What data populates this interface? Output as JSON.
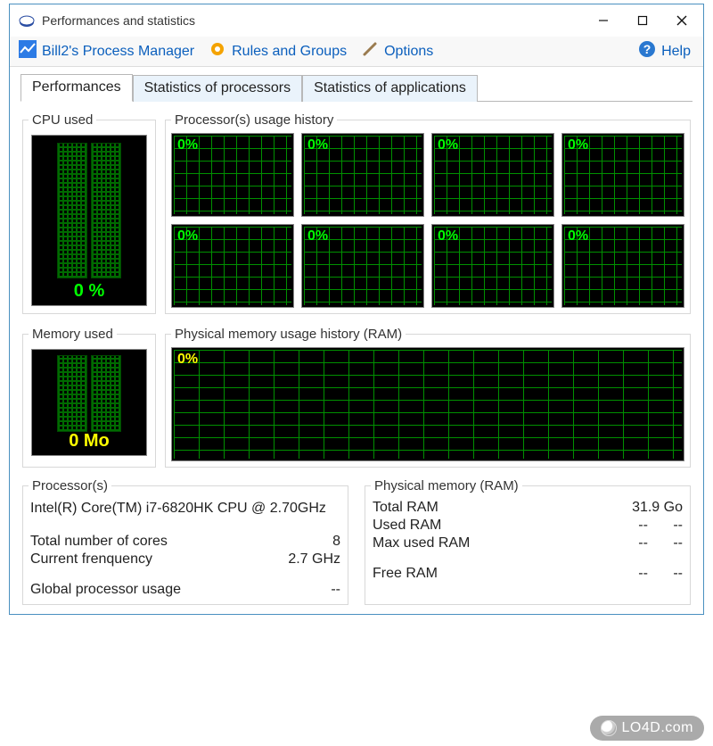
{
  "window": {
    "title": "Performances and statistics"
  },
  "toolbar": {
    "process_manager": "Bill2's Process Manager",
    "rules_groups": "Rules and Groups",
    "options": "Options",
    "help": "Help"
  },
  "tabs": [
    {
      "label": "Performances"
    },
    {
      "label": "Statistics of processors"
    },
    {
      "label": "Statistics of applications"
    }
  ],
  "groups": {
    "cpu_used": "CPU used",
    "proc_history": "Processor(s) usage history",
    "mem_used": "Memory used",
    "mem_history": "Physical memory usage history (RAM)",
    "processors": "Processor(s)",
    "physical_memory": "Physical memory (RAM)"
  },
  "cpu": {
    "big_value": "0 %",
    "cores": [
      "0%",
      "0%",
      "0%",
      "0%",
      "0%",
      "0%",
      "0%",
      "0%"
    ]
  },
  "memory": {
    "big_value": "0 Mo",
    "history_label": "0%"
  },
  "proc_info": {
    "name": "Intel(R) Core(TM) i7-6820HK CPU @ 2.70GHz",
    "cores_label": "Total number of cores",
    "cores_value": "8",
    "freq_label": "Current frenquency",
    "freq_value": "2.7 GHz",
    "global_label": "Global processor usage",
    "global_value": "--"
  },
  "ram_info": {
    "total_label": "Total RAM",
    "total_value": "31.9 Go",
    "used_label": "Used RAM",
    "used_v1": "--",
    "used_v2": "--",
    "max_label": "Max used RAM",
    "max_v1": "--",
    "max_v2": "--",
    "free_label": "Free RAM",
    "free_v1": "--",
    "free_v2": "--"
  },
  "watermark": "LO4D.com"
}
